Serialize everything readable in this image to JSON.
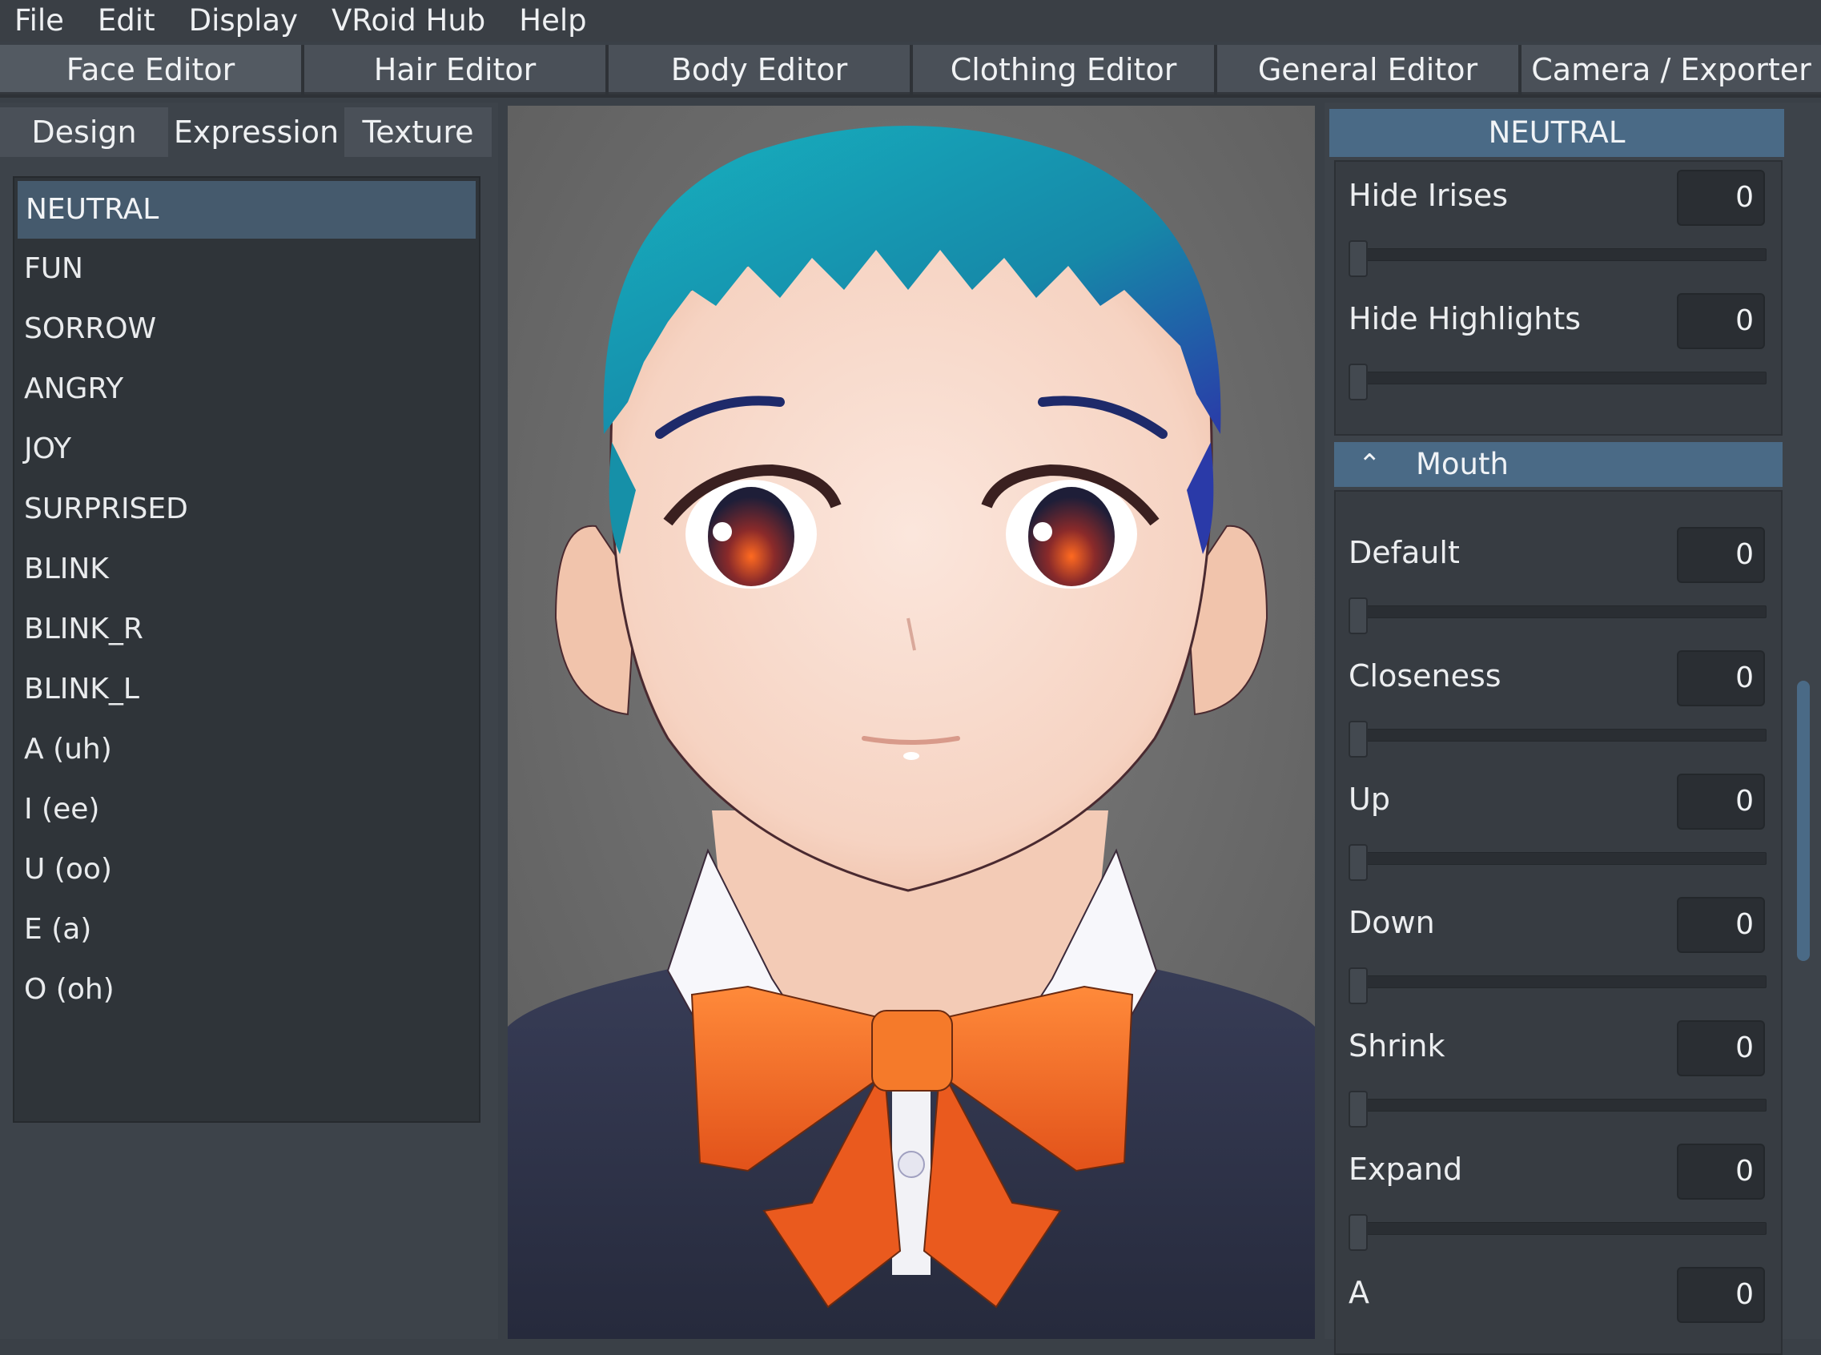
{
  "menu": [
    "File",
    "Edit",
    "Display",
    "VRoid Hub",
    "Help"
  ],
  "editor_tabs": [
    "Face Editor",
    "Hair Editor",
    "Body Editor",
    "Clothing Editor",
    "General Editor",
    "Camera / Exporter"
  ],
  "sub_tabs": [
    "Design",
    "Expression",
    "Texture"
  ],
  "expressions": [
    "NEUTRAL",
    "FUN",
    "SORROW",
    "ANGRY",
    "JOY",
    "SURPRISED",
    "BLINK",
    "BLINK_R",
    "BLINK_L",
    "A (uh)",
    "I (ee)",
    "U (oo)",
    "E (a)",
    "O (oh)"
  ],
  "right_panel": {
    "header": "NEUTRAL",
    "eye_params": [
      {
        "label": "Hide Irises",
        "value": "0"
      },
      {
        "label": "Hide Highlights",
        "value": "0"
      }
    ],
    "mouth_group": {
      "title": "Mouth",
      "params": [
        {
          "label": "Default",
          "value": "0"
        },
        {
          "label": "Closeness",
          "value": "0"
        },
        {
          "label": "Up",
          "value": "0"
        },
        {
          "label": "Down",
          "value": "0"
        },
        {
          "label": "Shrink",
          "value": "0"
        },
        {
          "label": "Expand",
          "value": "0"
        },
        {
          "label": "A",
          "value": "0"
        }
      ]
    }
  },
  "colors": {
    "accent": "#4a6a86",
    "hair": "#1a9aae",
    "bow": "#f06a20",
    "sweater": "#2f3348"
  }
}
